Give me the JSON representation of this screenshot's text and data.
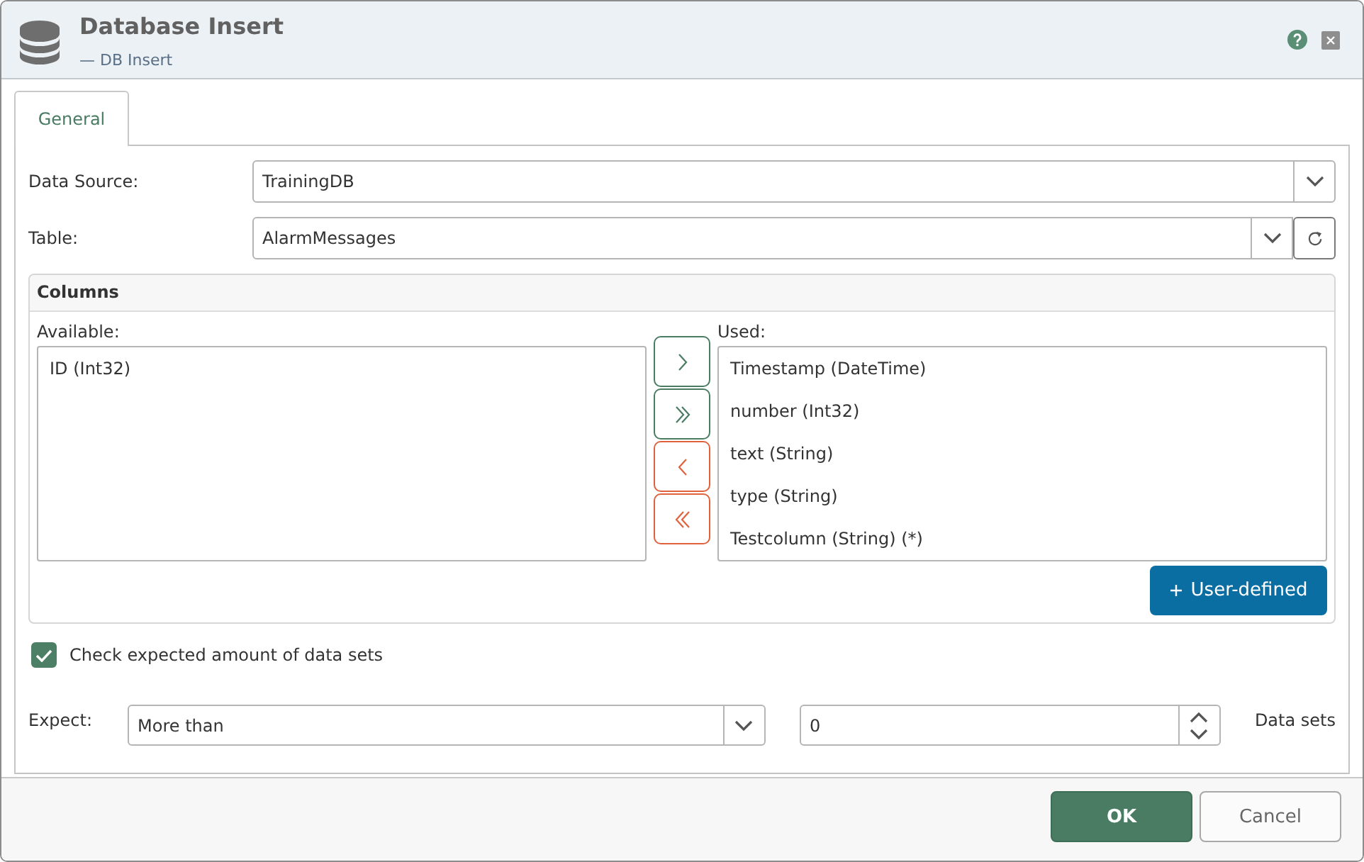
{
  "window": {
    "title": "Database Insert",
    "subtitle": "— DB Insert"
  },
  "tabs": [
    {
      "label": "General",
      "selected": true
    }
  ],
  "fields": [
    {
      "kind": "dropdown",
      "label": "Data Source:",
      "value": "TrainingDB"
    },
    {
      "kind": "dropdown_refresh",
      "label": "Table:",
      "value": "AlarmMessages"
    }
  ],
  "columns": {
    "title": "Columns",
    "available": {
      "label": "Available:",
      "items": [
        {
          "text": "ID (Int32)",
          "selected": false
        }
      ]
    },
    "move_buttons": [
      {
        "kind": "add"
      },
      {
        "kind": "add_all"
      },
      {
        "kind": "remove"
      },
      {
        "kind": "remove_all"
      }
    ],
    "used": {
      "label": "Used:",
      "items": [
        {
          "text": "Timestamp (DateTime)",
          "selected": false
        },
        {
          "text": "number (Int32)",
          "selected": false
        },
        {
          "text": "text (String)",
          "selected": false
        },
        {
          "text": "type (String)",
          "selected": false
        },
        {
          "text": "Testcolumn (String) (*)",
          "selected": false
        }
      ]
    },
    "user_defined_button": {
      "label": "User-defined"
    }
  },
  "check": {
    "label": "Check expected amount of data sets",
    "checked": true
  },
  "expect": {
    "label": "Expect:",
    "value": "More than",
    "amount": "0",
    "unit": "Data sets"
  },
  "buttons": [
    {
      "label": "OK",
      "kind": "primary"
    },
    {
      "label": "Cancel",
      "kind": "secondary"
    }
  ]
}
